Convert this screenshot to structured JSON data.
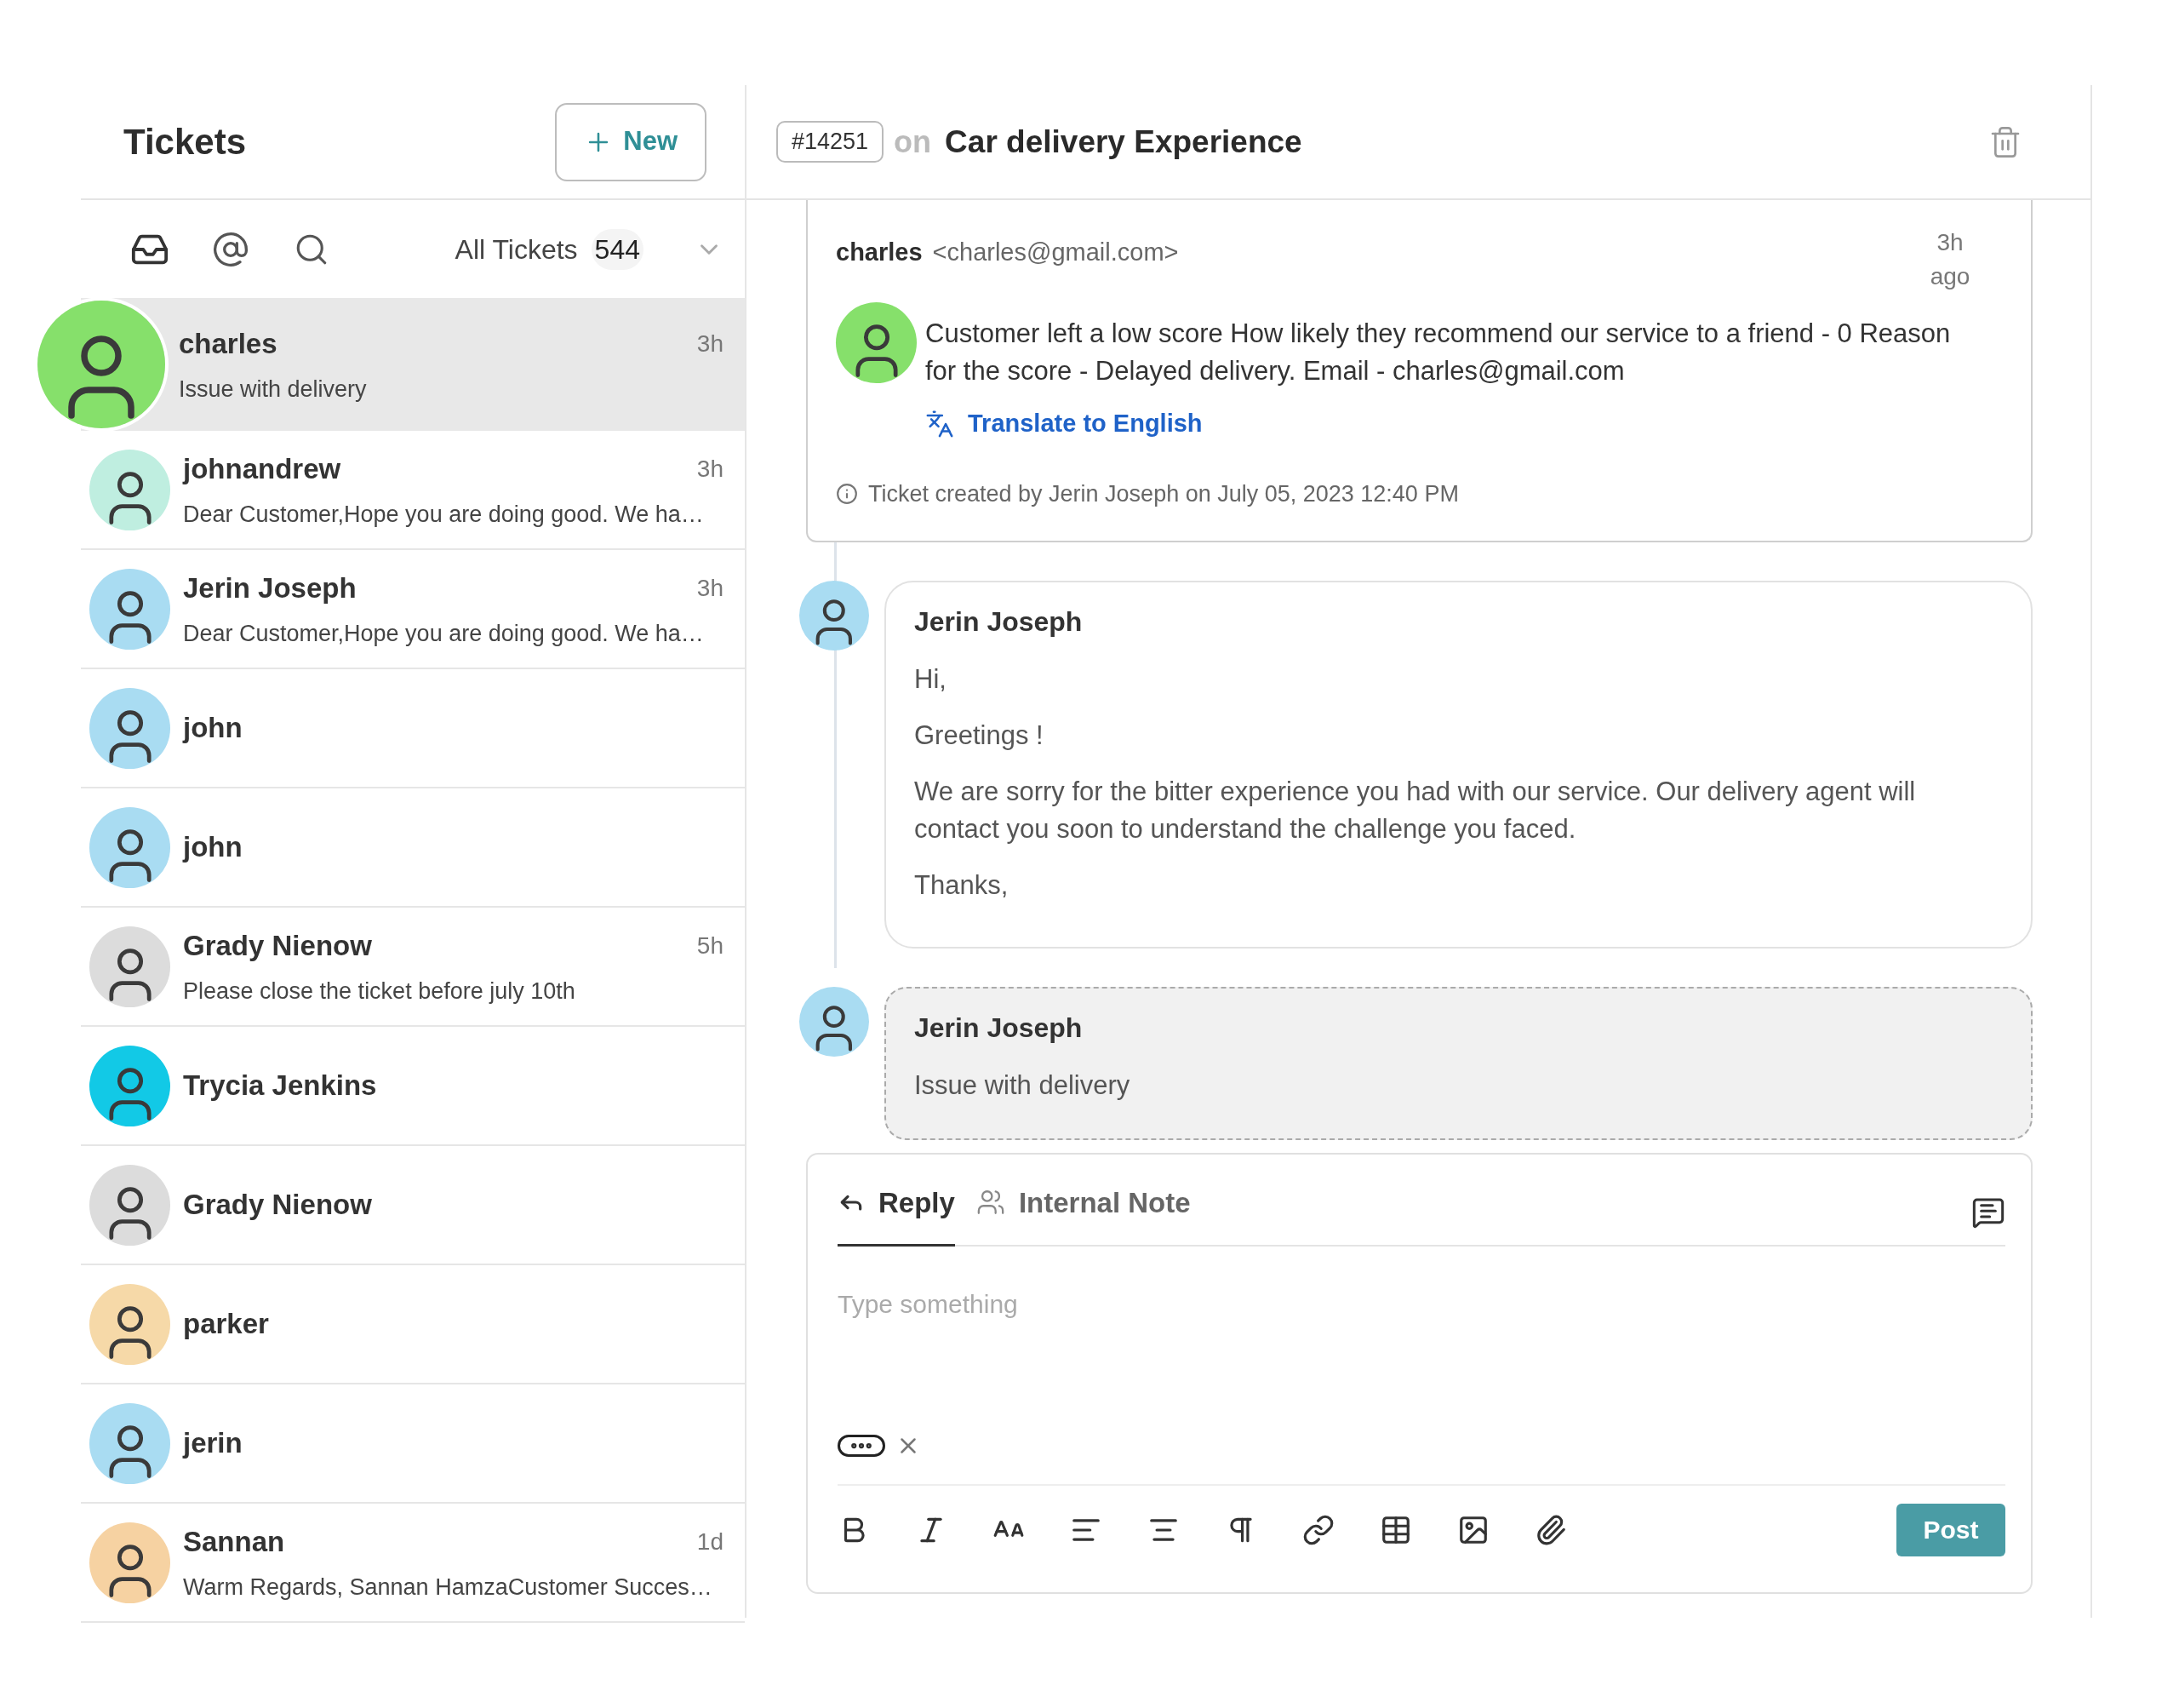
{
  "sidebar": {
    "title": "Tickets",
    "new_button": "New",
    "filter": {
      "label": "All Tickets",
      "count": "544"
    },
    "tickets": [
      {
        "name": "charles",
        "preview": "Issue with delivery",
        "time": "3h",
        "selected": true,
        "color": "#86e06b"
      },
      {
        "name": "johnandrew",
        "preview": "Dear Customer,Hope you are doing good. We ha…",
        "time": "3h",
        "selected": false,
        "color": "#bfeee0"
      },
      {
        "name": "Jerin Joseph",
        "preview": "Dear Customer,Hope you are doing good. We ha…",
        "time": "3h",
        "selected": false,
        "color": "#a9dcf2"
      },
      {
        "name": "john",
        "selected": false,
        "color": "#a9dcf2"
      },
      {
        "name": "john",
        "selected": false,
        "color": "#a9dcf2"
      },
      {
        "name": "Grady Nienow",
        "preview": "Please close the ticket before july 10th",
        "time": "5h",
        "selected": false,
        "color": "#dcdcdc"
      },
      {
        "name": "Trycia Jenkins",
        "selected": false,
        "color": "#12c9e6"
      },
      {
        "name": "Grady Nienow",
        "selected": false,
        "color": "#dcdcdc"
      },
      {
        "name": "parker",
        "selected": false,
        "color": "#f6d9a8"
      },
      {
        "name": "jerin",
        "selected": false,
        "color": "#a9dcf2"
      },
      {
        "name": "Sannan",
        "preview": "Warm Regards, Sannan HamzaCustomer Succes…",
        "time": "1d",
        "selected": false,
        "color": "#f6d2a2"
      }
    ]
  },
  "ticket": {
    "number": "#14251",
    "on": "on",
    "title": "Car delivery Experience"
  },
  "first_message": {
    "sender": "charles",
    "email": "<charles@gmail.com>",
    "time": "3h ago",
    "body": "Customer left a low score How likely they recommend our service to a friend - 0 Reason for the score - Delayed delivery. Email - charles@gmail.com",
    "translate": "Translate to English",
    "created": "Ticket created by Jerin Joseph on July 05, 2023 12:40 PM"
  },
  "thread": [
    {
      "kind": "reply",
      "author": "Jerin Joseph",
      "paragraphs": [
        "Hi,",
        "Greetings !",
        "We are sorry for the bitter experience you had with our service. Our delivery agent will contact you soon to understand the challenge you faced.",
        "Thanks,"
      ]
    },
    {
      "kind": "note",
      "author": "Jerin Joseph",
      "paragraphs": [
        "Issue with delivery"
      ]
    }
  ],
  "editor": {
    "tabs": [
      {
        "label": "Reply",
        "kind": "reply",
        "selected": true
      },
      {
        "label": "Internal Note",
        "kind": "note",
        "selected": false
      }
    ],
    "placeholder": "Type something",
    "post": "Post"
  }
}
